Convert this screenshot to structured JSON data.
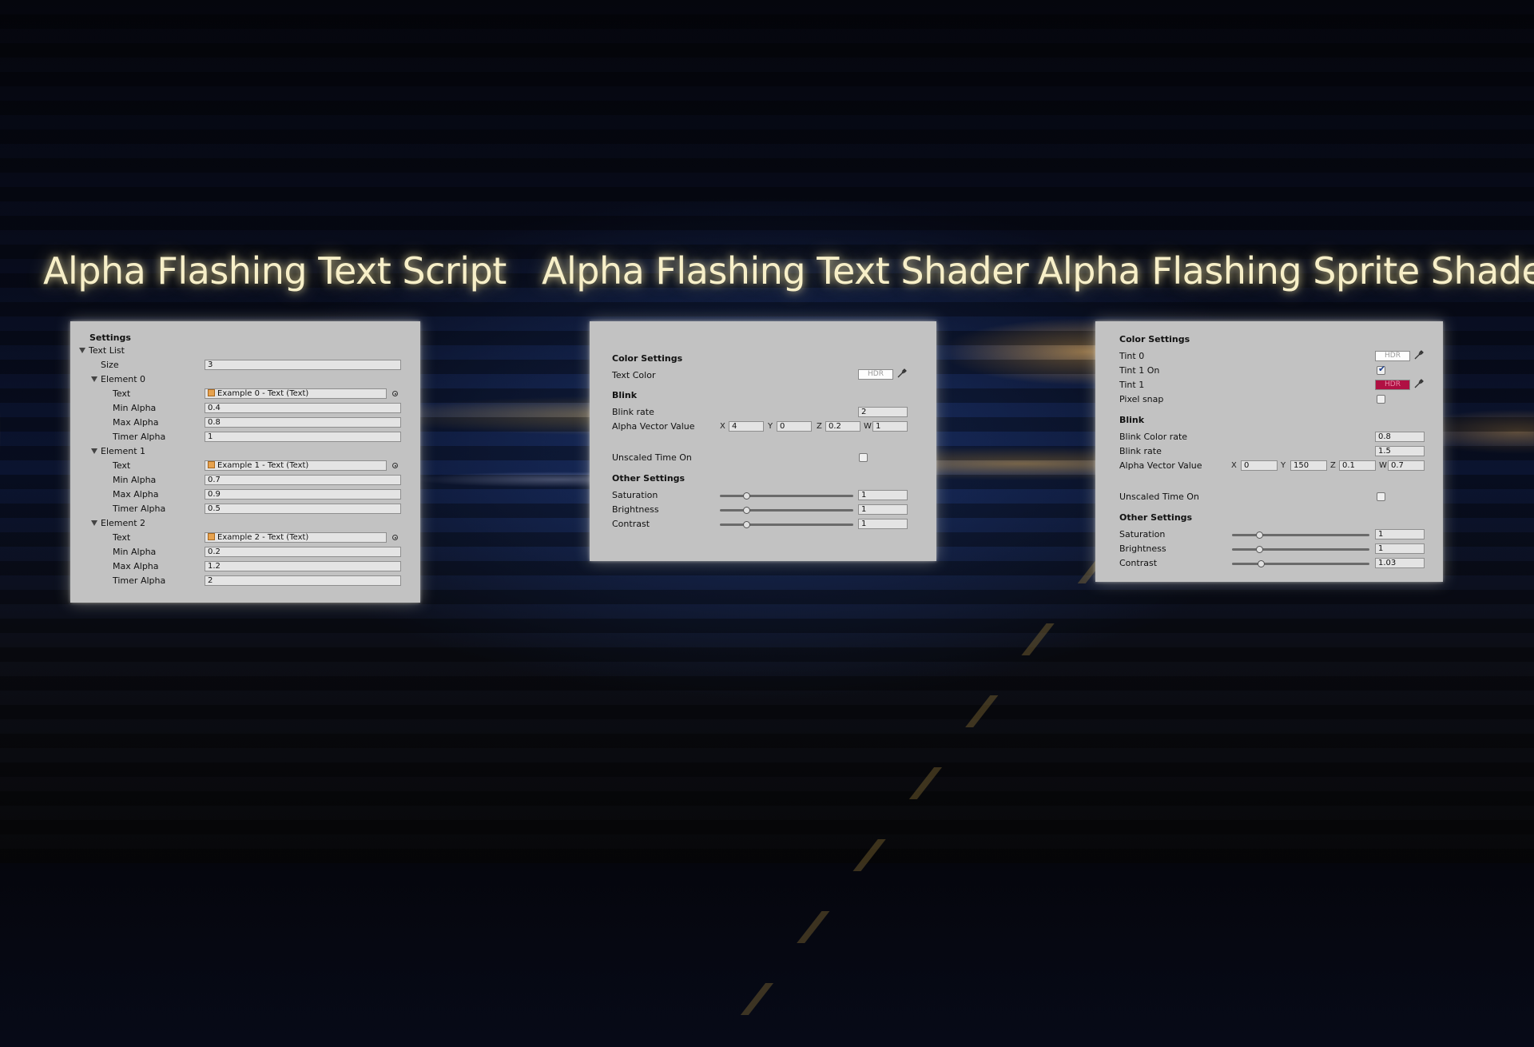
{
  "headings": {
    "script": "Alpha Flashing Text Script",
    "text_shader": "Alpha Flashing Text Shader",
    "sprite_shader": "Alpha Flashing Sprite Shader"
  },
  "script_panel": {
    "section_title": "Settings",
    "text_list_label": "Text List",
    "size_label": "Size",
    "size_value": "3",
    "elements": [
      {
        "label": "Element 0",
        "text_label": "Text",
        "text_value": "Example 0 - Text (Text)",
        "min_alpha_label": "Min Alpha",
        "min_alpha": "0.4",
        "max_alpha_label": "Max Alpha",
        "max_alpha": "0.8",
        "timer_alpha_label": "Timer Alpha",
        "timer_alpha": "1"
      },
      {
        "label": "Element 1",
        "text_label": "Text",
        "text_value": "Example 1 - Text (Text)",
        "min_alpha_label": "Min Alpha",
        "min_alpha": "0.7",
        "max_alpha_label": "Max Alpha",
        "max_alpha": "0.9",
        "timer_alpha_label": "Timer Alpha",
        "timer_alpha": "0.5"
      },
      {
        "label": "Element 2",
        "text_label": "Text",
        "text_value": "Example 2 - Text (Text)",
        "min_alpha_label": "Min Alpha",
        "min_alpha": "0.2",
        "max_alpha_label": "Max Alpha",
        "max_alpha": "1.2",
        "timer_alpha_label": "Timer Alpha",
        "timer_alpha": "2"
      }
    ]
  },
  "text_shader_panel": {
    "color_settings": "Color Settings",
    "text_color_label": "Text Color",
    "hdr": "HDR",
    "blink": "Blink",
    "blink_rate_label": "Blink rate",
    "blink_rate": "2",
    "alpha_vector_label": "Alpha Vector Value",
    "alpha_vector": {
      "x_label": "X",
      "x": "4",
      "y_label": "Y",
      "y": "0",
      "z_label": "Z",
      "z": "0.2",
      "w_label": "W",
      "w": "1"
    },
    "unscaled_label": "Unscaled Time On",
    "unscaled_checked": false,
    "other_settings": "Other Settings",
    "saturation_label": "Saturation",
    "saturation": "1",
    "saturation_level": 0.2,
    "brightness_label": "Brightness",
    "brightness": "1",
    "brightness_level": 0.2,
    "contrast_label": "Contrast",
    "contrast": "1",
    "contrast_level": 0.2
  },
  "sprite_shader_panel": {
    "color_settings": "Color Settings",
    "tint0_label": "Tint 0",
    "tint0_color": "#fdfdfd",
    "hdr": "HDR",
    "tint1_on_label": "Tint 1 On",
    "tint1_on_checked": true,
    "tint1_label": "Tint 1",
    "tint1_color": "#b01043",
    "pixel_snap_label": "Pixel snap",
    "pixel_snap_checked": false,
    "blink": "Blink",
    "blink_color_rate_label": "Blink Color rate",
    "blink_color_rate": "0.8",
    "blink_rate_label": "Blink rate",
    "blink_rate": "1.5",
    "alpha_vector_label": "Alpha Vector Value",
    "alpha_vector": {
      "x_label": "X",
      "x": "0",
      "y_label": "Y",
      "y": "150",
      "z_label": "Z",
      "z": "0.1",
      "w_label": "W",
      "w": "0.7"
    },
    "unscaled_label": "Unscaled Time On",
    "unscaled_checked": false,
    "other_settings": "Other Settings",
    "saturation_label": "Saturation",
    "saturation": "1",
    "saturation_level": 0.2,
    "brightness_label": "Brightness",
    "brightness": "1",
    "brightness_level": 0.2,
    "contrast_label": "Contrast",
    "contrast": "1.03",
    "contrast_level": 0.21
  },
  "colors": {
    "heading": "#f7efc8",
    "panel": "#c2c2c2",
    "tint1": "#b01043"
  }
}
